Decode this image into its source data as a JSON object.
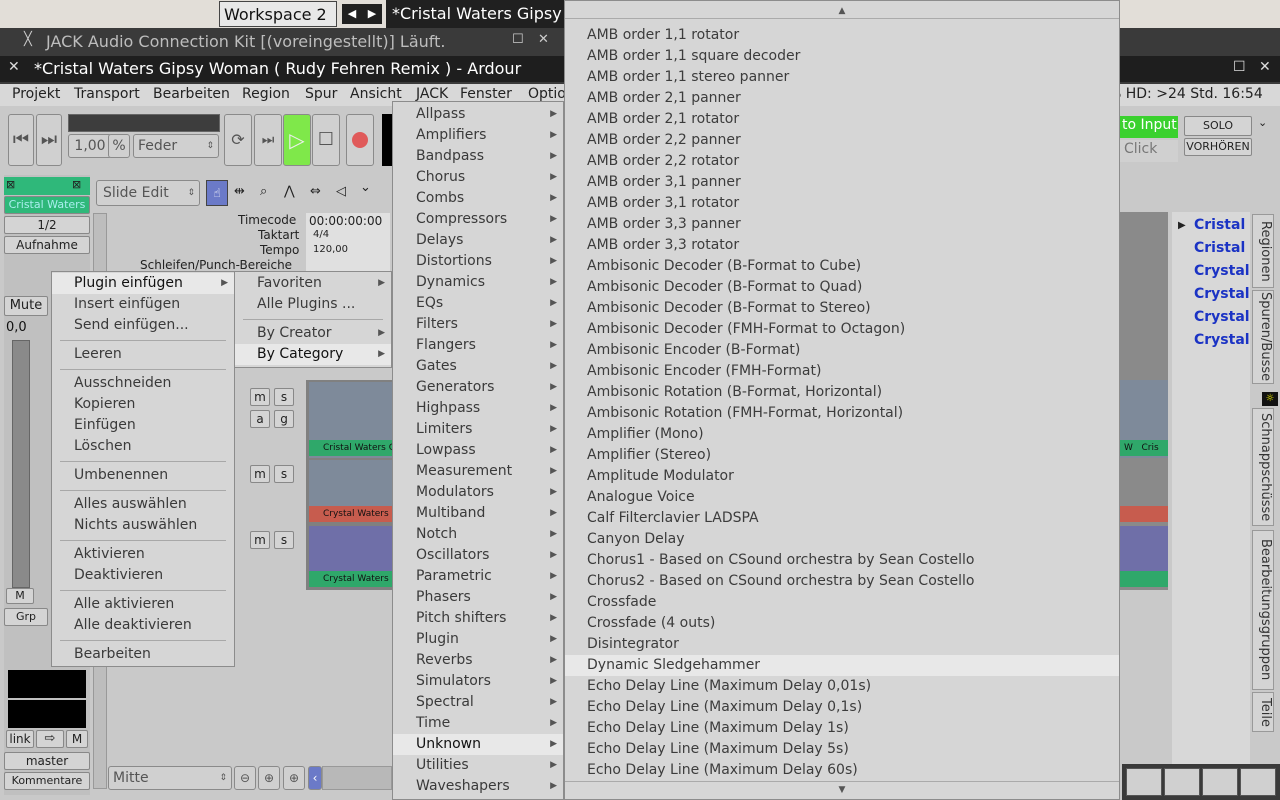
{
  "desktop": {
    "workspace_label": "Workspace 2",
    "window_title_tab": "*Cristal Waters Gipsy",
    "jack_title": "JACK Audio Connection Kit [(voreingestellt)] Läuft."
  },
  "ardour": {
    "title": "*Cristal Waters Gipsy Woman ( Rudy Fehren Remix ) - Ardour",
    "menu": [
      "Projekt",
      "Transport",
      "Bearbeiten",
      "Region",
      "Spur",
      "Ansicht",
      "JACK",
      "Fenster",
      "Optio"
    ],
    "status_right": "% HD: >24 Std. 16:54",
    "shuttle_value": "1,00",
    "shuttle_unit": "%",
    "shuttle_mode": "Feder",
    "edit_mode": "Slide Edit",
    "to_input": "to Input",
    "click": "Click",
    "solo": "SOLO",
    "vorhoeren": "VORHÖREN",
    "track_name": "Cristal Waters",
    "track_ratio": "1/2",
    "aufnahme": "Aufnahme",
    "mute": "Mute",
    "gain": "0,0",
    "m_btn": "M",
    "grp": "Grp",
    "link": "link",
    "m2": "M",
    "master": "master",
    "kommentare": "Kommentare",
    "zoom_focus": "Mitte",
    "rulers": {
      "timecode": "Timecode",
      "taktart": "Taktart",
      "tempo": "Tempo",
      "loops": "Schleifen/Punch-Bereiche",
      "timecode_val": "00:00:00:00",
      "taktart_val": "4/4",
      "tempo_val": "120,00"
    },
    "region_labels": [
      "Cristal Waters Gy",
      "Crystal Waters G",
      "Crystal Waters Gy"
    ],
    "region_right_labels": [
      "W",
      "Cris"
    ],
    "regions_list": [
      "Cristal W",
      "Cristal W",
      "Crystal",
      "Crystal",
      "Crystal",
      "Crystal"
    ],
    "right_tabs": [
      "Regionen",
      "Spuren/Busse",
      "Schnappschüsse",
      "Bearbeitungsgruppen",
      "Teile"
    ]
  },
  "menu1": {
    "items": [
      {
        "label": "Plugin einfügen",
        "submenu": true,
        "highlight": true
      },
      {
        "label": "Insert einfügen"
      },
      {
        "label": "Send einfügen..."
      },
      {
        "sep": true
      },
      {
        "label": "Leeren"
      },
      {
        "sep": true
      },
      {
        "label": "Ausschneiden"
      },
      {
        "label": "Kopieren"
      },
      {
        "label": "Einfügen"
      },
      {
        "label": "Löschen"
      },
      {
        "sep": true
      },
      {
        "label": "Umbenennen"
      },
      {
        "sep": true
      },
      {
        "label": "Alles auswählen"
      },
      {
        "label": "Nichts auswählen"
      },
      {
        "sep": true
      },
      {
        "label": "Aktivieren"
      },
      {
        "label": "Deaktivieren"
      },
      {
        "sep": true
      },
      {
        "label": "Alle aktivieren"
      },
      {
        "label": "Alle deaktivieren"
      },
      {
        "sep": true
      },
      {
        "label": "Bearbeiten"
      }
    ]
  },
  "menu2": {
    "items": [
      {
        "label": "Favoriten",
        "submenu": true
      },
      {
        "label": "Alle Plugins ..."
      },
      {
        "sep": true
      },
      {
        "label": "By Creator",
        "submenu": true
      },
      {
        "label": "By Category",
        "submenu": true,
        "highlight": true
      }
    ]
  },
  "menu3": {
    "items": [
      "Allpass",
      "Amplifiers",
      "Bandpass",
      "Chorus",
      "Combs",
      "Compressors",
      "Delays",
      "Distortions",
      "Dynamics",
      "EQs",
      "Filters",
      "Flangers",
      "Gates",
      "Generators",
      "Highpass",
      "Limiters",
      "Lowpass",
      "Measurement",
      "Modulators",
      "Multiband",
      "Notch",
      "Oscillators",
      "Parametric",
      "Phasers",
      "Pitch shifters",
      "Plugin",
      "Reverbs",
      "Simulators",
      "Spectral",
      "Time",
      "Unknown",
      "Utilities",
      "Waveshapers"
    ],
    "highlight": "Unknown"
  },
  "menu4": {
    "items": [
      "AMB order 1,1 rotator",
      "AMB order 1,1 square decoder",
      "AMB order 1,1 stereo panner",
      "AMB order 2,1 panner",
      "AMB order 2,1 rotator",
      "AMB order 2,2 panner",
      "AMB order 2,2 rotator",
      "AMB order 3,1 panner",
      "AMB order 3,1 rotator",
      "AMB order 3,3 panner",
      "AMB order 3,3 rotator",
      "Ambisonic Decoder (B-Format to Cube)",
      "Ambisonic Decoder (B-Format to Quad)",
      "Ambisonic Decoder (B-Format to Stereo)",
      "Ambisonic Decoder (FMH-Format to Octagon)",
      "Ambisonic Encoder (B-Format)",
      "Ambisonic Encoder (FMH-Format)",
      "Ambisonic Rotation (B-Format, Horizontal)",
      "Ambisonic Rotation (FMH-Format, Horizontal)",
      "Amplifier (Mono)",
      "Amplifier (Stereo)",
      "Amplitude Modulator",
      "Analogue Voice",
      "Calf Filterclavier LADSPA",
      "Canyon Delay",
      "Chorus1 - Based on CSound orchestra by Sean Costello",
      "Chorus2 - Based on CSound orchestra by Sean Costello",
      "Crossfade",
      "Crossfade (4 outs)",
      "Disintegrator",
      "Dynamic Sledgehammer",
      "Echo Delay Line (Maximum Delay 0,01s)",
      "Echo Delay Line (Maximum Delay 0,1s)",
      "Echo Delay Line (Maximum Delay 1s)",
      "Echo Delay Line (Maximum Delay 5s)",
      "Echo Delay Line (Maximum Delay 60s)"
    ],
    "highlight": "Dynamic Sledgehammer"
  }
}
